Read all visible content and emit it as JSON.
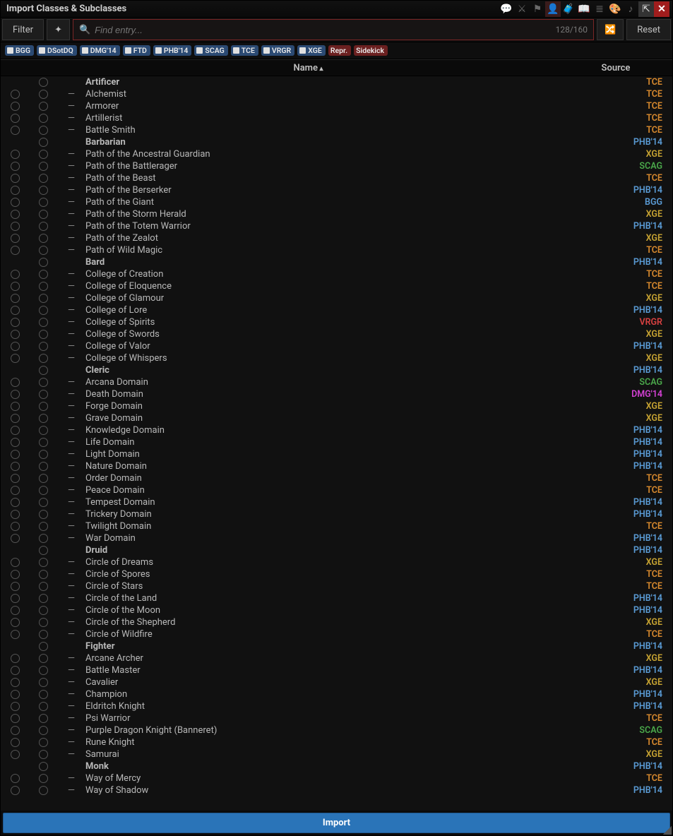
{
  "title": "Import Classes & Subclasses",
  "toolbar": {
    "filter_label": "Filter",
    "reset_label": "Reset",
    "search_placeholder": "Find entry...",
    "count": "128/160"
  },
  "pills": [
    {
      "label": "BGG",
      "on": true
    },
    {
      "label": "DSotDQ",
      "on": true
    },
    {
      "label": "DMG'14",
      "on": true
    },
    {
      "label": "FTD",
      "on": true
    },
    {
      "label": "PHB'14",
      "on": true
    },
    {
      "label": "SCAG",
      "on": true
    },
    {
      "label": "TCE",
      "on": true
    },
    {
      "label": "VRGR",
      "on": true
    },
    {
      "label": "XGE",
      "on": true
    },
    {
      "label": "Repr.",
      "on": false,
      "red": true
    },
    {
      "label": "Sidekick",
      "on": false,
      "red": true
    }
  ],
  "columns": {
    "name": "Name",
    "source": "Source"
  },
  "rows": [
    {
      "t": "c",
      "name": "Artificer",
      "src": "TCE"
    },
    {
      "t": "s",
      "name": "Alchemist",
      "src": "TCE"
    },
    {
      "t": "s",
      "name": "Armorer",
      "src": "TCE"
    },
    {
      "t": "s",
      "name": "Artillerist",
      "src": "TCE"
    },
    {
      "t": "s",
      "name": "Battle Smith",
      "src": "TCE"
    },
    {
      "t": "c",
      "name": "Barbarian",
      "src": "PHB'14"
    },
    {
      "t": "s",
      "name": "Path of the Ancestral Guardian",
      "src": "XGE"
    },
    {
      "t": "s",
      "name": "Path of the Battlerager",
      "src": "SCAG"
    },
    {
      "t": "s",
      "name": "Path of the Beast",
      "src": "TCE"
    },
    {
      "t": "s",
      "name": "Path of the Berserker",
      "src": "PHB'14"
    },
    {
      "t": "s",
      "name": "Path of the Giant",
      "src": "BGG"
    },
    {
      "t": "s",
      "name": "Path of the Storm Herald",
      "src": "XGE"
    },
    {
      "t": "s",
      "name": "Path of the Totem Warrior",
      "src": "PHB'14"
    },
    {
      "t": "s",
      "name": "Path of the Zealot",
      "src": "XGE"
    },
    {
      "t": "s",
      "name": "Path of Wild Magic",
      "src": "TCE"
    },
    {
      "t": "c",
      "name": "Bard",
      "src": "PHB'14"
    },
    {
      "t": "s",
      "name": "College of Creation",
      "src": "TCE"
    },
    {
      "t": "s",
      "name": "College of Eloquence",
      "src": "TCE"
    },
    {
      "t": "s",
      "name": "College of Glamour",
      "src": "XGE"
    },
    {
      "t": "s",
      "name": "College of Lore",
      "src": "PHB'14"
    },
    {
      "t": "s",
      "name": "College of Spirits",
      "src": "VRGR"
    },
    {
      "t": "s",
      "name": "College of Swords",
      "src": "XGE"
    },
    {
      "t": "s",
      "name": "College of Valor",
      "src": "PHB'14"
    },
    {
      "t": "s",
      "name": "College of Whispers",
      "src": "XGE"
    },
    {
      "t": "c",
      "name": "Cleric",
      "src": "PHB'14"
    },
    {
      "t": "s",
      "name": "Arcana Domain",
      "src": "SCAG"
    },
    {
      "t": "s",
      "name": "Death Domain",
      "src": "DMG'14"
    },
    {
      "t": "s",
      "name": "Forge Domain",
      "src": "XGE"
    },
    {
      "t": "s",
      "name": "Grave Domain",
      "src": "XGE"
    },
    {
      "t": "s",
      "name": "Knowledge Domain",
      "src": "PHB'14"
    },
    {
      "t": "s",
      "name": "Life Domain",
      "src": "PHB'14"
    },
    {
      "t": "s",
      "name": "Light Domain",
      "src": "PHB'14"
    },
    {
      "t": "s",
      "name": "Nature Domain",
      "src": "PHB'14"
    },
    {
      "t": "s",
      "name": "Order Domain",
      "src": "TCE"
    },
    {
      "t": "s",
      "name": "Peace Domain",
      "src": "TCE"
    },
    {
      "t": "s",
      "name": "Tempest Domain",
      "src": "PHB'14"
    },
    {
      "t": "s",
      "name": "Trickery Domain",
      "src": "PHB'14"
    },
    {
      "t": "s",
      "name": "Twilight Domain",
      "src": "TCE"
    },
    {
      "t": "s",
      "name": "War Domain",
      "src": "PHB'14"
    },
    {
      "t": "c",
      "name": "Druid",
      "src": "PHB'14"
    },
    {
      "t": "s",
      "name": "Circle of Dreams",
      "src": "XGE"
    },
    {
      "t": "s",
      "name": "Circle of Spores",
      "src": "TCE"
    },
    {
      "t": "s",
      "name": "Circle of Stars",
      "src": "TCE"
    },
    {
      "t": "s",
      "name": "Circle of the Land",
      "src": "PHB'14"
    },
    {
      "t": "s",
      "name": "Circle of the Moon",
      "src": "PHB'14"
    },
    {
      "t": "s",
      "name": "Circle of the Shepherd",
      "src": "XGE"
    },
    {
      "t": "s",
      "name": "Circle of Wildfire",
      "src": "TCE"
    },
    {
      "t": "c",
      "name": "Fighter",
      "src": "PHB'14"
    },
    {
      "t": "s",
      "name": "Arcane Archer",
      "src": "XGE"
    },
    {
      "t": "s",
      "name": "Battle Master",
      "src": "PHB'14"
    },
    {
      "t": "s",
      "name": "Cavalier",
      "src": "XGE"
    },
    {
      "t": "s",
      "name": "Champion",
      "src": "PHB'14"
    },
    {
      "t": "s",
      "name": "Eldritch Knight",
      "src": "PHB'14"
    },
    {
      "t": "s",
      "name": "Psi Warrior",
      "src": "TCE"
    },
    {
      "t": "s",
      "name": "Purple Dragon Knight (Banneret)",
      "src": "SCAG"
    },
    {
      "t": "s",
      "name": "Rune Knight",
      "src": "TCE"
    },
    {
      "t": "s",
      "name": "Samurai",
      "src": "XGE"
    },
    {
      "t": "c",
      "name": "Monk",
      "src": "PHB'14"
    },
    {
      "t": "s",
      "name": "Way of Mercy",
      "src": "TCE"
    },
    {
      "t": "s",
      "name": "Way of Shadow",
      "src": "PHB'14"
    }
  ],
  "footer": {
    "import_label": "Import"
  }
}
